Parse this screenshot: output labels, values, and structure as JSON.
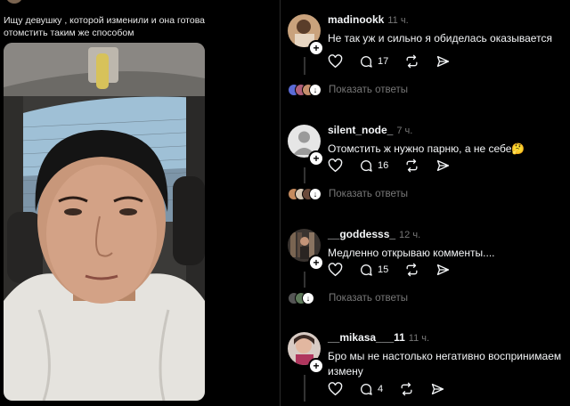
{
  "post": {
    "text": "Ищу девушку , которой изменили и она готова отомстить таким же способом"
  },
  "comments": [
    {
      "username": "madinookk",
      "time": "11 ч.",
      "text": "Не так уж и сильно я обиделась оказывается",
      "replies": "17",
      "show_replies": "Показать ответы"
    },
    {
      "username": "silent_node_",
      "time": "7 ч.",
      "text": "Отомстить ж нужно парню, а не себе🤔",
      "replies": "16",
      "show_replies": "Показать ответы"
    },
    {
      "username": "__goddesss_",
      "time": "12 ч.",
      "text": "Медленно открываю комменты....",
      "replies": "15",
      "show_replies": "Показать ответы"
    },
    {
      "username": "__mikasa___11",
      "time": "11 ч.",
      "text": "Бро мы не настолько негативно воспринимаем измену",
      "replies": "4",
      "show_replies": ""
    }
  ],
  "icons": [
    "heart-icon",
    "reply-icon",
    "repost-icon",
    "share-icon",
    "follow-plus-icon",
    "download-arrow-icon"
  ],
  "colors": {
    "background": "#000000",
    "text": "#f3f5f7",
    "muted": "#777777",
    "line": "#333333"
  }
}
